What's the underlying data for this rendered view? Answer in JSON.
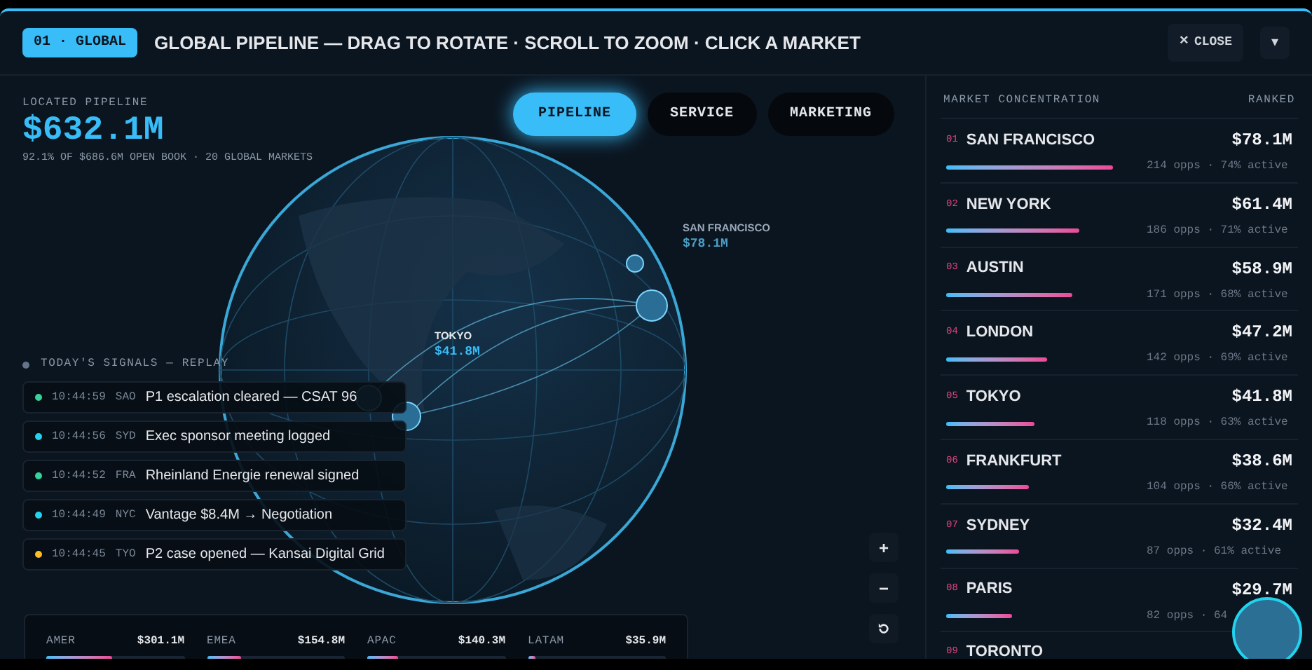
{
  "header": {
    "badge": "01 · GLOBAL",
    "title": "GLOBAL PIPELINE — DRAG TO ROTATE · SCROLL TO ZOOM · CLICK A MARKET",
    "close": "CLOSE",
    "close_icon": "×",
    "menu_icon": "▾"
  },
  "summary": {
    "label": "LOCATED PIPELINE",
    "value": "$632.1M",
    "note": "92.1% OF $686.6M OPEN BOOK · 20 GLOBAL MARKETS"
  },
  "tabs": [
    {
      "label": "PIPELINE",
      "selected": true
    },
    {
      "label": "SERVICE",
      "selected": false
    },
    {
      "label": "MARKETING",
      "selected": false
    }
  ],
  "globe_markers": [
    {
      "name": "SAN FRANCISCO",
      "value": "$78.1M"
    },
    {
      "name": "TOKYO",
      "value": "$41.8M"
    }
  ],
  "signals": {
    "title": "TODAY'S SIGNALS — REPLAY",
    "items": [
      {
        "time": "10:44:59",
        "code": "SAO",
        "text": "P1 escalation cleared — CSAT 96",
        "color": "#34d399"
      },
      {
        "time": "10:44:56",
        "code": "SYD",
        "text": "Exec sponsor meeting logged",
        "color": "#22d3ee"
      },
      {
        "time": "10:44:52",
        "code": "FRA",
        "text": "Rheinland Energie renewal signed",
        "color": "#34d399"
      },
      {
        "time": "10:44:49",
        "code": "NYC",
        "text": "Vantage $8.4M → Negotiation",
        "color": "#22d3ee"
      },
      {
        "time": "10:44:45",
        "code": "TYO",
        "text": "P2 case opened — Kansai Digital Grid",
        "color": "#fbbf24"
      }
    ]
  },
  "regions": [
    {
      "name": "AMER",
      "value": "$301.1M",
      "level": 0.48
    },
    {
      "name": "EMEA",
      "value": "$154.8M",
      "level": 0.25
    },
    {
      "name": "APAC",
      "value": "$140.3M",
      "level": 0.22
    },
    {
      "name": "LATAM",
      "value": "$35.9M",
      "level": 0.06
    }
  ],
  "zoom_controls": [
    "+",
    "−"
  ],
  "markets": {
    "title": "MARKET CONCENTRATION",
    "sort": "RANKED",
    "rows": [
      {
        "rank": "01",
        "name": "SAN FRANCISCO",
        "value": "$78.1M",
        "detail": "214 opps · 74% active",
        "level": 0.53
      },
      {
        "rank": "02",
        "name": "NEW YORK",
        "value": "$61.4M",
        "detail": "186 opps · 71% active",
        "level": 0.42
      },
      {
        "rank": "03",
        "name": "AUSTIN",
        "value": "$58.9M",
        "detail": "171 opps · 68% active",
        "level": 0.4
      },
      {
        "rank": "04",
        "name": "LONDON",
        "value": "$47.2M",
        "detail": "142 opps · 69% active",
        "level": 0.32
      },
      {
        "rank": "05",
        "name": "TOKYO",
        "value": "$41.8M",
        "detail": "118 opps · 63% active",
        "level": 0.28
      },
      {
        "rank": "06",
        "name": "FRANKFURT",
        "value": "$38.6M",
        "detail": "104 opps · 66% active",
        "level": 0.26
      },
      {
        "rank": "07",
        "name": "SYDNEY",
        "value": "$32.4M",
        "detail": "87 opps · 61% active",
        "level": 0.23
      },
      {
        "rank": "08",
        "name": "PARIS",
        "value": "$29.7M",
        "detail": "82 opps · 64",
        "level": 0.21
      },
      {
        "rank": "09",
        "name": "TORONTO"
      }
    ]
  }
}
